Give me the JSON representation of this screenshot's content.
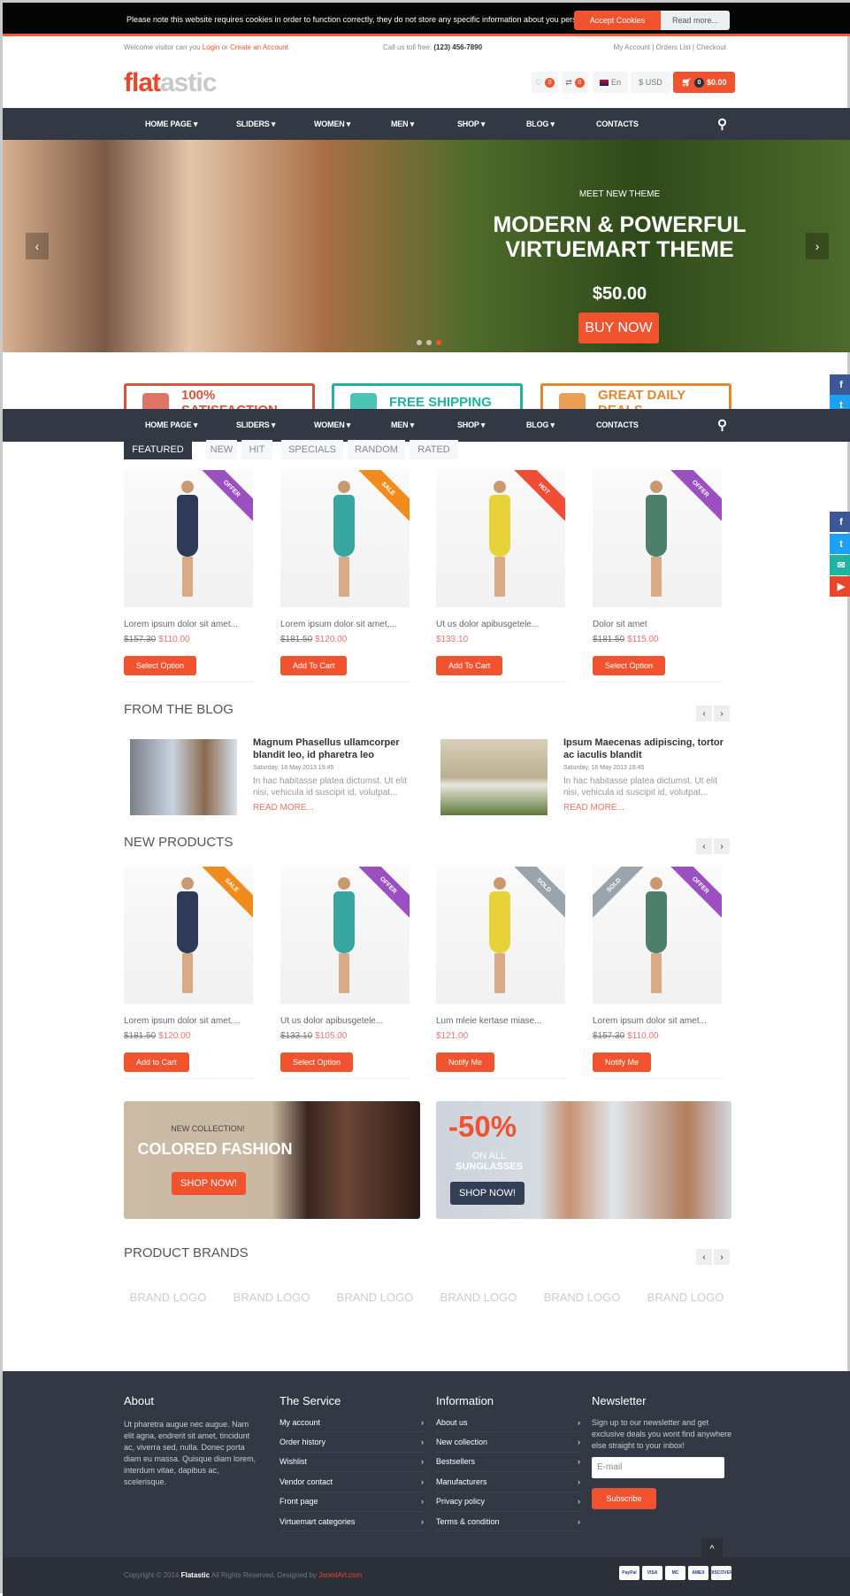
{
  "cookie": {
    "text": "Please note this website requires cookies in order to function correctly, they do not store any specific information about you personally.",
    "accept": "Accept Cookies",
    "read_more": "Read more..."
  },
  "topbar": {
    "welcome": "Welcome visitor can you",
    "login": "Login",
    "or": "or",
    "create": "Create an Account",
    "call": "Call us toll free:",
    "phone": "(123) 456-7890",
    "links": [
      "My Account",
      "Orders List",
      "Checkout"
    ]
  },
  "header": {
    "logo_a": "flat",
    "logo_b": "astic",
    "wishlist_count": "0",
    "compare_count": "0",
    "lang": "En",
    "currency": "$ USD",
    "cart_count": "0",
    "cart_total": "$0.00"
  },
  "nav": {
    "items": [
      "HOME PAGE ▾",
      "SLIDERS ▾",
      "WOMEN ▾",
      "MEN ▾",
      "SHOP ▾",
      "BLOG ▾",
      "CONTACTS"
    ]
  },
  "hero": {
    "kicker": "MEET NEW THEME",
    "title1": "MODERN & POWERFUL",
    "title2": "VIRTUEMART THEME",
    "price": "$50.00",
    "button": "BUY NOW",
    "slides": 3,
    "active_slide": 3
  },
  "features": [
    {
      "label": "100% SATISFACTION",
      "color": "#d9533f"
    },
    {
      "label": "FREE SHIPPING",
      "color": "#1fb4a0"
    },
    {
      "label": "GREAT DAILY DEALS",
      "color": "#e4872b"
    }
  ],
  "tabs": [
    "FEATURED",
    "NEW",
    "HIT",
    "SPECIALS",
    "RANDOM",
    "RATED"
  ],
  "featured": [
    {
      "ribbon": "OFFER",
      "ribbon_color": "#9b4fc0",
      "title": "Lorem ipsum dolor sit amet...",
      "old": "$157.30",
      "price": "$110.00",
      "button": "Select Option"
    },
    {
      "ribbon": "SALE",
      "ribbon_color": "#f08c1c",
      "title": "Lorem ipsum dolor sit amet,...",
      "old": "$181.50",
      "price": "$120.00",
      "button": "Add To Cart"
    },
    {
      "ribbon": "HOT",
      "ribbon_color": "#ef4d36",
      "title": "Ut us dolor apibusgetele...",
      "old": "",
      "price": "$133.10",
      "button": "Add To Cart"
    },
    {
      "ribbon": "OFFER",
      "ribbon_color": "#9b4fc0",
      "title": "Dolor sit amet",
      "old": "$181.50",
      "price": "$115.00",
      "button": "Select Option"
    }
  ],
  "blog": {
    "heading": "FROM THE BLOG",
    "posts": [
      {
        "title": "Magnum Phasellus ullamcorper blandit leo, id pharetra leo",
        "date": "Saturday, 18 May 2013 19:45",
        "text": "In hac habitasse platea dictumst. Ut elit nisi, vehicula id suscipit id, volutpat...",
        "more": "READ MORE..."
      },
      {
        "title": "Ipsum Maecenas adipiscing, tortor ac iaculis blandit",
        "date": "Saturday, 18 May 2013 19:45",
        "text": "In hac habitasse platea dictumst. Ut elit nisi, vehicula id suscipit id, volutpat...",
        "more": "READ MORE..."
      }
    ]
  },
  "new_products": {
    "heading": "NEW PRODUCTS",
    "items": [
      {
        "ribbon": "SALE",
        "ribbon_color": "#f08c1c",
        "title": "Lorem ipsum dolor sit amet,...",
        "old": "$181.50",
        "price": "$120.00",
        "button": "Add to Cart"
      },
      {
        "ribbon": "OFFER",
        "ribbon_color": "#9b4fc0",
        "title": "Ut us dolor apibusgetele...",
        "old": "$133.10",
        "price": "$105.00",
        "button": "Select Option"
      },
      {
        "ribbon": "SOLD",
        "ribbon_color": "#9aa4ad",
        "title": "Lum mleie kertase miase...",
        "old": "",
        "price": "$121.00",
        "button": "Notify Me"
      },
      {
        "ribbon": "SOLD",
        "ribbon_color": "#9aa4ad",
        "ribbon2": "OFFER",
        "ribbon2_color": "#9b4fc0",
        "title": "Lorem ipsum dolor sit amet...",
        "old": "$157.30",
        "price": "$110.00",
        "button": "Notify Me"
      }
    ]
  },
  "banners": {
    "b1_kicker": "NEW COLLECTION!",
    "b1_title": "COLORED FASHION",
    "b1_button": "SHOP NOW!",
    "b2_big": "-50%",
    "b2_line1": "ON ALL",
    "b2_line2": "SUNGLASSES",
    "b2_button": "SHOP NOW!"
  },
  "brands": {
    "heading": "PRODUCT BRANDS",
    "logos": [
      "BRAND LOGO",
      "BRAND LOGO",
      "BRAND LOGO",
      "BRAND LOGO",
      "BRAND LOGO",
      "BRAND LOGO"
    ]
  },
  "footer": {
    "about_h": "About",
    "about": "Ut pharetra augue nec augue. Nam elit agna, endrerit sit amet, tincidunt ac, viverra sed, nulla. Donec porta diam eu massa. Quisque diam lorem, interdum vitae, dapibus ac, scelerisque.",
    "service_h": "The Service",
    "service": [
      "My account",
      "Order history",
      "Wishlist",
      "Vendor contact",
      "Front page",
      "Virtuemart categories"
    ],
    "info_h": "Information",
    "info": [
      "About us",
      "New collection",
      "Bestsellers",
      "Manufacturers",
      "Privacy policy",
      "Terms & condition"
    ],
    "news_h": "Newsletter",
    "news_text": "Sign up to our newsletter and get exclusive deals you wont find anywhere else straight to your inbox!",
    "email_placeholder": "E-mail",
    "subscribe": "Subscribe"
  },
  "bottom": {
    "copy": "Copyright © 2014",
    "brand": "Flatastic",
    "rights": "All Rights Reserved. Designed by",
    "designer": "JoomlArt.com",
    "payments": [
      "PayPal",
      "VISA",
      "MC",
      "AMEX",
      "DISCOVER"
    ]
  },
  "colors": {
    "accent": "#f1532f",
    "nav": "#323844"
  }
}
